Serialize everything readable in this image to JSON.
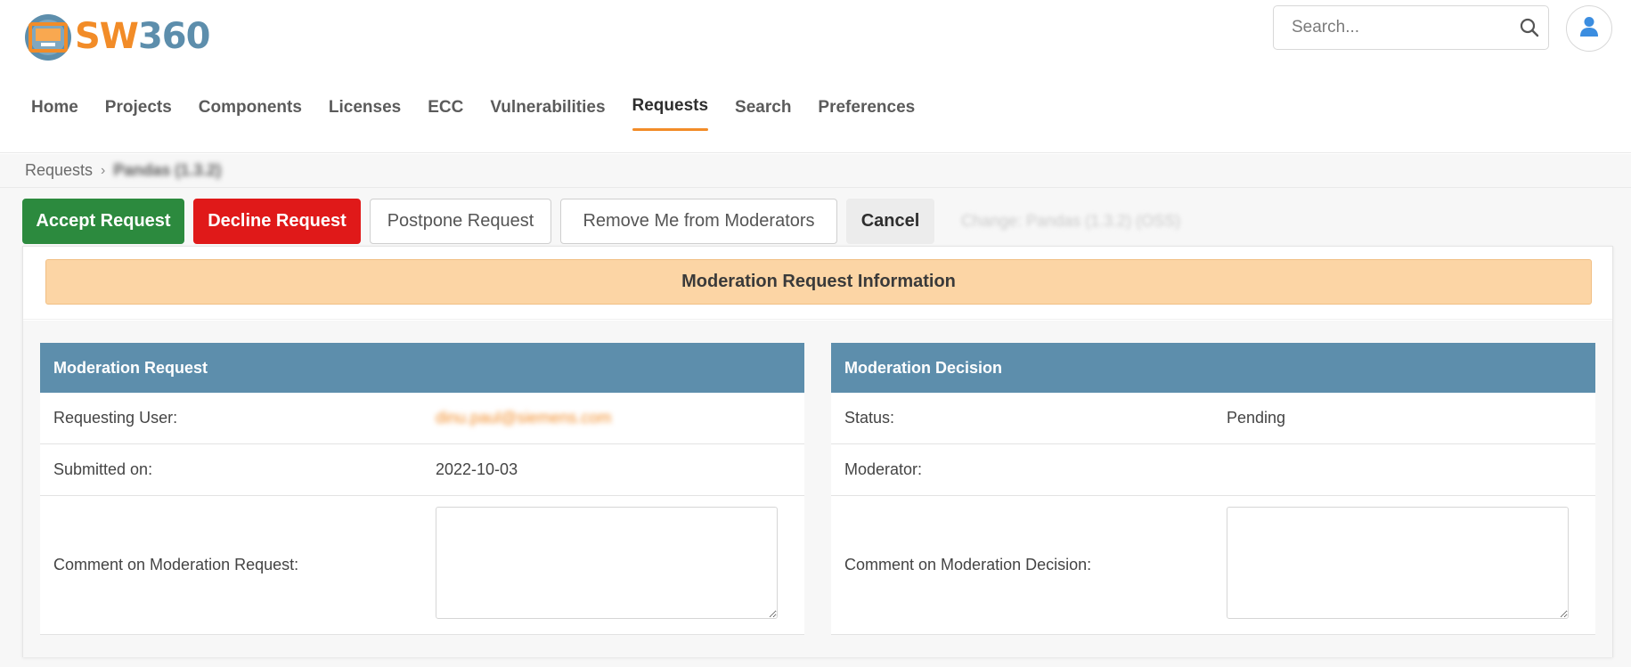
{
  "app": {
    "logo_prefix": "SW",
    "logo_suffix": "360"
  },
  "search": {
    "placeholder": "Search..."
  },
  "nav": {
    "items": [
      "Home",
      "Projects",
      "Components",
      "Licenses",
      "ECC",
      "Vulnerabilities",
      "Requests",
      "Search",
      "Preferences"
    ],
    "active": "Requests"
  },
  "breadcrumb": {
    "parent": "Requests",
    "current": "Pandas (1.3.2)"
  },
  "toolbar": {
    "accept_label": "Accept Request",
    "decline_label": "Decline Request",
    "postpone_label": "Postpone Request",
    "remove_label": "Remove Me from Moderators",
    "cancel_label": "Cancel",
    "change_title": "Change: Pandas (1.3.2) (OSS)"
  },
  "banner": {
    "title": "Moderation Request Information"
  },
  "moderation_request": {
    "title": "Moderation Request",
    "requesting_user_label": "Requesting User:",
    "requesting_user_value": "dinu.paul@siemens.com",
    "submitted_label": "Submitted on:",
    "submitted_value": "2022-10-03",
    "comment_label": "Comment on Moderation Request:",
    "comment_value": ""
  },
  "moderation_decision": {
    "title": "Moderation Decision",
    "status_label": "Status:",
    "status_value": "Pending",
    "moderator_label": "Moderator:",
    "moderator_value": "",
    "comment_label": "Comment on Moderation Decision:",
    "comment_value": ""
  },
  "colors": {
    "accent_orange": "#f28c28",
    "brand_blue": "#5d8eac",
    "accept_green": "#2c8a3e",
    "decline_red": "#e01919",
    "banner_peach": "#fcd5a5"
  }
}
